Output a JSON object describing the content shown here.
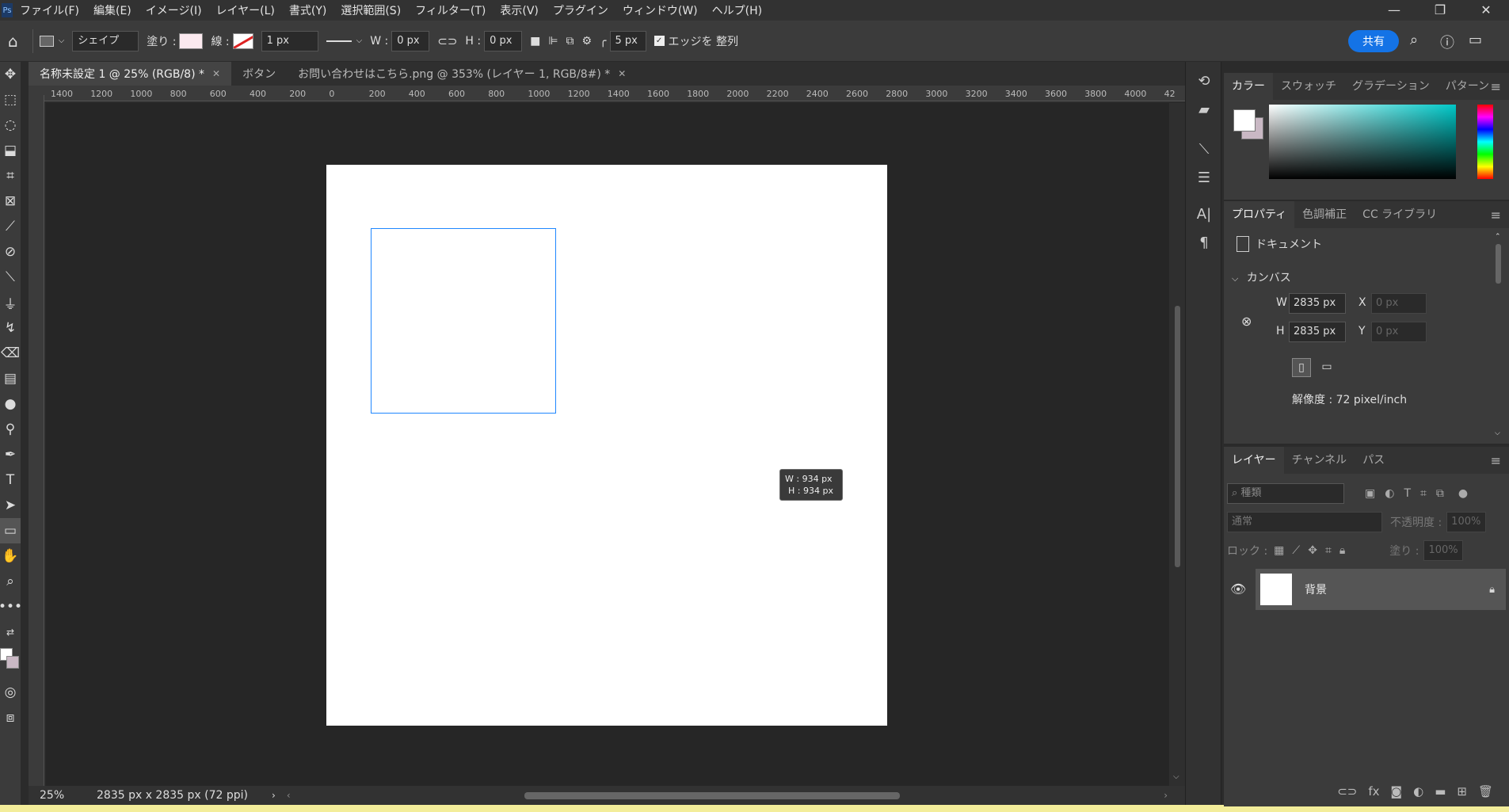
{
  "menubar": {
    "logo": "Ps",
    "items": [
      "ファイル(F)",
      "編集(E)",
      "イメージ(I)",
      "レイヤー(L)",
      "書式(Y)",
      "選択範囲(S)",
      "フィルター(T)",
      "表示(V)",
      "プラグイン",
      "ウィンドウ(W)",
      "ヘルプ(H)"
    ],
    "minimize": "—",
    "restore": "❐",
    "close": "✕"
  },
  "options": {
    "shape_mode": "シェイプ",
    "fill_label": "塗り :",
    "stroke_label": "線 :",
    "stroke_width": "1 px",
    "w_label": "W :",
    "w_value": "0 px",
    "h_label": "H :",
    "h_value": "0 px",
    "radius": "5 px",
    "align_edges": "エッジを 整列",
    "share": "共有"
  },
  "tabs": [
    {
      "label": "名称未設定 1 @ 25% (RGB/8) *",
      "active": true
    },
    {
      "label": "ボタン",
      "active": false
    },
    {
      "label": "お問い合わせはこちら.png @ 353% (レイヤー 1, RGB/8#) *",
      "active": false
    }
  ],
  "ruler": [
    "1400",
    "1200",
    "1000",
    "800",
    "600",
    "400",
    "200",
    "0",
    "200",
    "400",
    "600",
    "800",
    "1000",
    "1200",
    "1400",
    "1600",
    "1800",
    "2000",
    "2200",
    "2400",
    "2600",
    "2800",
    "3000",
    "3200",
    "3400",
    "3600",
    "3800",
    "4000",
    "42"
  ],
  "tooltip": {
    "w": "W : 934 px",
    "h": "H : 934 px"
  },
  "status": {
    "zoom": "25%",
    "doc_size": "2835 px x 2835 px (72 ppi)"
  },
  "color_panel": {
    "tabs": [
      "カラー",
      "スウォッチ",
      "グラデーション",
      "パターン"
    ]
  },
  "properties": {
    "tabs": [
      "プロパティ",
      "色調補正",
      "CC ライブラリ"
    ],
    "doc_label": "ドキュメント",
    "canvas_label": "カンバス",
    "w_label": "W",
    "w_value": "2835 px",
    "h_label": "H",
    "h_value": "2835 px",
    "x_label": "X",
    "x_placeholder": "0 px",
    "y_label": "Y",
    "y_placeholder": "0 px",
    "resolution": "解像度 : 72 pixel/inch"
  },
  "layers": {
    "tabs": [
      "レイヤー",
      "チャンネル",
      "パス"
    ],
    "filter_placeholder": "種類",
    "blend_mode": "通常",
    "opacity_label": "不透明度 :",
    "opacity_value": "100%",
    "lock_label": "ロック :",
    "fill_label": "塗り :",
    "fill_value": "100%",
    "background_layer": "背景"
  }
}
